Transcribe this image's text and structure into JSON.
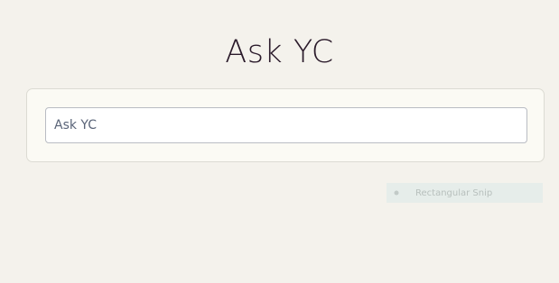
{
  "header": {
    "title": "Ask YC"
  },
  "search": {
    "placeholder": "Ask YC",
    "value": ""
  },
  "snip_tool": {
    "label": "Rectangular Snip",
    "icon": "snip-icon"
  }
}
